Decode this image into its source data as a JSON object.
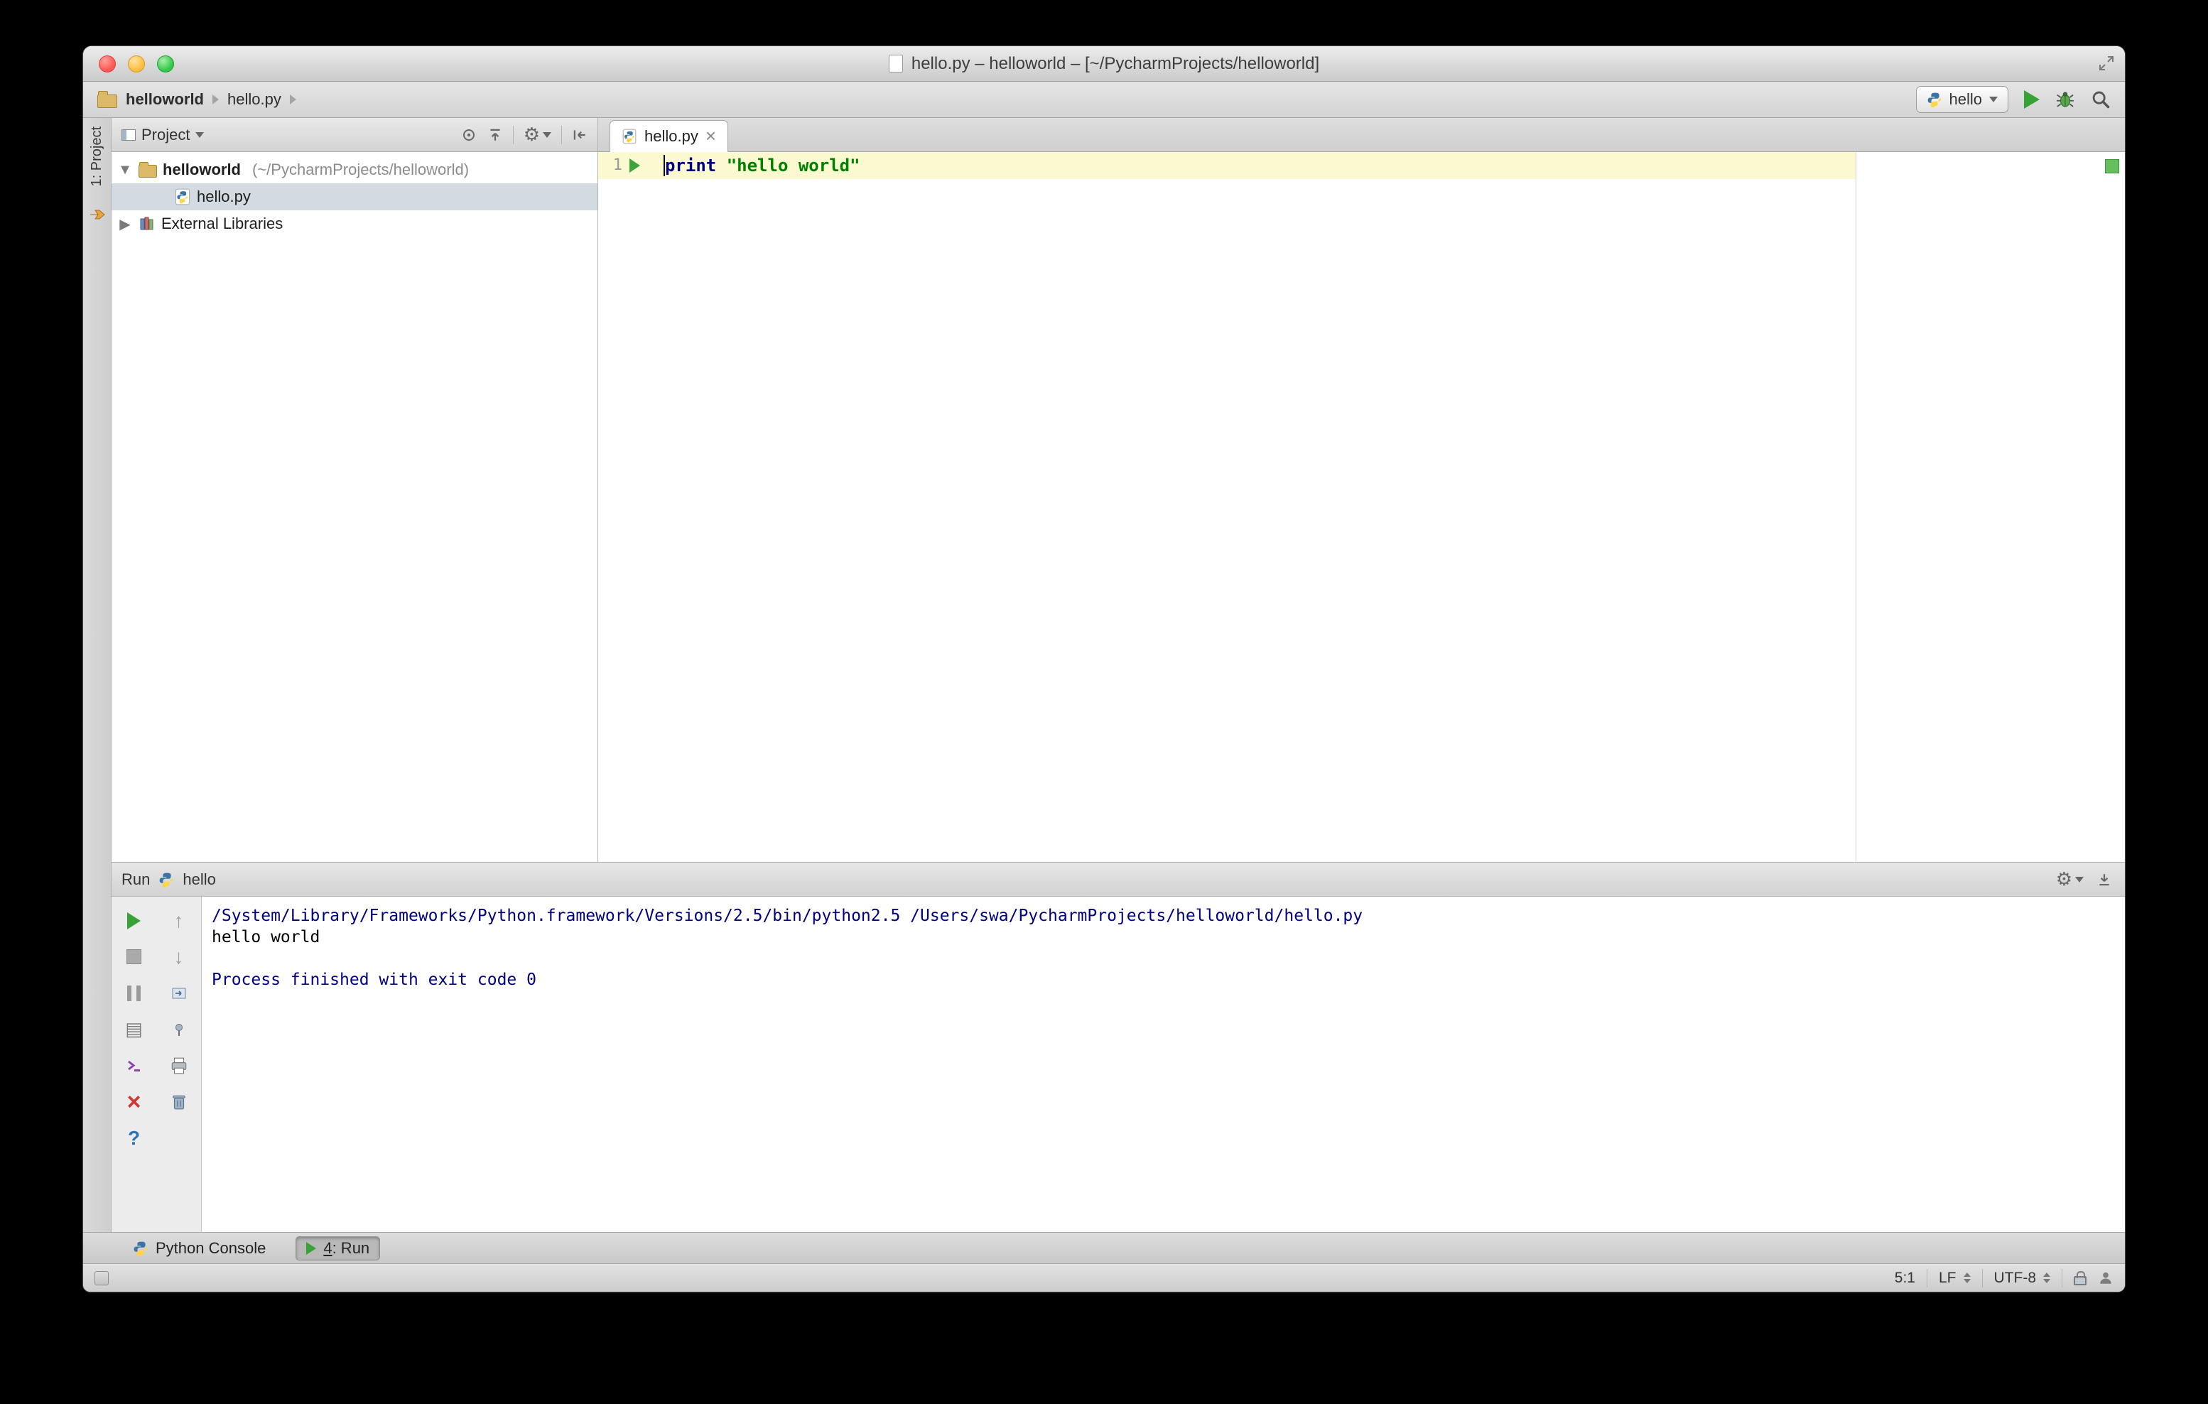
{
  "window": {
    "title": "hello.py – helloworld – [~/PycharmProjects/helloworld]"
  },
  "breadcrumb": {
    "project": "helloworld",
    "file": "hello.py",
    "run_config": "hello"
  },
  "tool_strip": {
    "project_label": "1: Project"
  },
  "project_panel": {
    "header_label": "Project",
    "tree": {
      "project_name": "helloworld",
      "project_path": "(~/PycharmProjects/helloworld)",
      "file_name": "hello.py",
      "external_libraries": "External Libraries"
    }
  },
  "editor": {
    "tab_label": "hello.py",
    "line_number": "1",
    "keyword": "print",
    "string_literal": " \"hello world\""
  },
  "run_panel": {
    "label": "Run",
    "config_name": "hello",
    "lines": [
      "/System/Library/Frameworks/Python.framework/Versions/2.5/bin/python2.5 /Users/swa/PycharmProjects/helloworld/hello.py",
      "hello world",
      "",
      "Process finished with exit code 0"
    ]
  },
  "bottom_bar": {
    "python_console_label": "Python Console",
    "run_tab_number": "4",
    "run_tab_suffix": ": Run"
  },
  "status_bar": {
    "caret_position": "5:1",
    "line_separator": "LF",
    "encoding": "UTF-8"
  },
  "colors": {
    "keyword": "#000080",
    "string": "#008000",
    "console_system": "#000080",
    "accent_green": "#37a337",
    "caret_line": "#fbf9cf",
    "selection": "#d2dae2"
  }
}
